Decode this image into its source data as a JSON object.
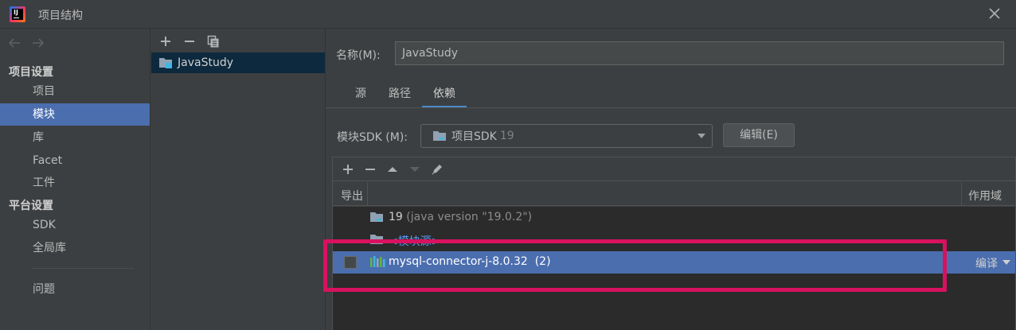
{
  "window": {
    "title": "项目结构",
    "app_icon_text": "IJ"
  },
  "nav": {
    "back_icon": "arrow-left-icon",
    "forward_icon": "arrow-right-icon",
    "sections": [
      {
        "title": "项目设置",
        "items": [
          "项目",
          "模块",
          "库",
          "Facet",
          "工件"
        ]
      },
      {
        "title": "平台设置",
        "items": [
          "SDK",
          "全局库"
        ]
      }
    ],
    "problems": "问题",
    "selected": "模块"
  },
  "modules": {
    "toolbar": [
      "add-icon",
      "remove-icon",
      "copy-icon"
    ],
    "items": [
      "JavaStudy"
    ]
  },
  "content": {
    "name_label": "名称(M):",
    "name_value": "JavaStudy",
    "tabs": [
      "源",
      "路径",
      "依赖"
    ],
    "active_tab": "依赖",
    "sdk_label": "模块SDK (M):",
    "sdk_value": "项目SDK",
    "sdk_version": "19",
    "edit_button": "编辑(E)",
    "dep_toolbar": [
      "add-icon",
      "remove-icon",
      "move-up-icon",
      "move-down-icon",
      "edit-icon"
    ],
    "table_headers": {
      "export": "导出",
      "scope": "作用域"
    },
    "dependencies": [
      {
        "type": "sdk",
        "name": "19",
        "detail": "(java version \"19.0.2\")"
      },
      {
        "type": "source",
        "name": "<模块源>"
      },
      {
        "type": "library",
        "name": "mysql-connector-j-8.0.32",
        "count": "(2)",
        "scope": "编译",
        "exported": false,
        "selected": true
      }
    ]
  },
  "colors": {
    "background": "#3c3f41",
    "selection": "#4b6eaf",
    "highlight_box": "#d8125f",
    "link_blue": "#589df6"
  }
}
